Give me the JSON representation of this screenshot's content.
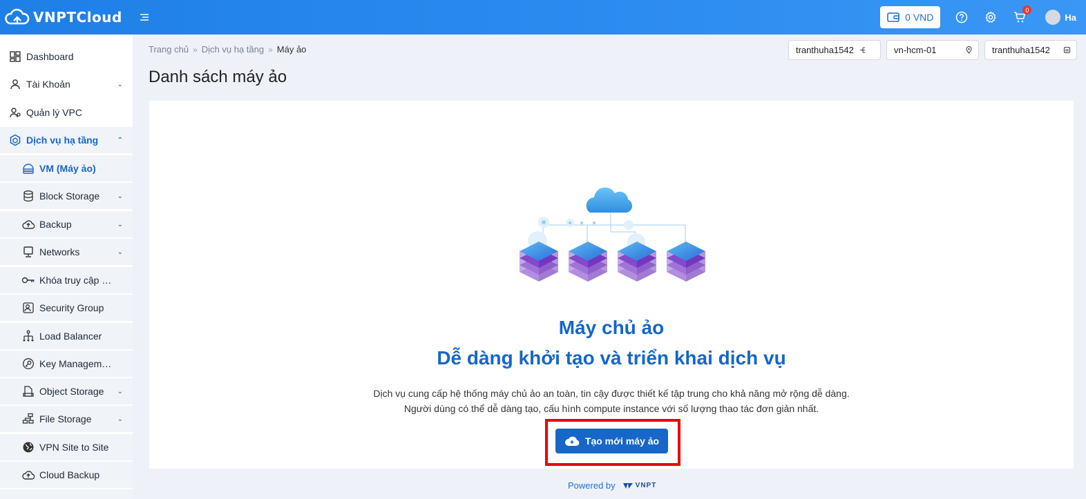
{
  "app": {
    "brand": "VNPTCloud"
  },
  "header": {
    "balance": "0 VND",
    "cart_count": "0",
    "user_name": "Ha"
  },
  "sidebar": {
    "items": [
      {
        "label": "Dashboard",
        "icon": "dashboard-icon"
      },
      {
        "label": "Tài Khoản",
        "icon": "user-icon"
      },
      {
        "label": "Quản lý VPC",
        "icon": "vpc-icon"
      },
      {
        "label": "Dịch vụ hạ tầng",
        "icon": "infrastructure-icon"
      },
      {
        "label": "VM (Máy ảo)",
        "icon": "vm-icon"
      },
      {
        "label": "Block Storage",
        "icon": "database-icon"
      },
      {
        "label": "Backup",
        "icon": "cloud-upload-icon"
      },
      {
        "label": "Networks",
        "icon": "monitor-icon"
      },
      {
        "label": "Khóa truy cập SSH",
        "icon": "key-icon"
      },
      {
        "label": "Security Group",
        "icon": "security-group-icon"
      },
      {
        "label": "Load Balancer",
        "icon": "load-balancer-icon"
      },
      {
        "label": "Key Management",
        "icon": "key-management-icon"
      },
      {
        "label": "Object Storage",
        "icon": "object-storage-icon"
      },
      {
        "label": "File Storage",
        "icon": "file-storage-icon"
      },
      {
        "label": "VPN Site to Site",
        "icon": "globe-icon"
      },
      {
        "label": "Cloud Backup",
        "icon": "cloud-backup-icon"
      }
    ]
  },
  "breadcrumb": {
    "home": "Trang chủ",
    "section": "Dịch vụ hạ tầng",
    "current": "Máy ảo"
  },
  "selectors": {
    "project": "tranthuha1542",
    "region": "vn-hcm-01",
    "account": "tranthuha1542"
  },
  "page": {
    "title": "Danh sách máy ảo"
  },
  "empty_state": {
    "title": "Máy chủ ảo",
    "subtitle": "Dễ dàng khởi tạo và triển khai dịch vụ",
    "desc_line1": "Dịch vụ cung cấp hệ thống máy chủ ảo an toàn, tin cậy được thiết kế tập trung cho khả năng mở rộng dễ dàng.",
    "desc_line2": "Người dùng có thể dễ dàng tạo, cấu hình compute instance với số lượng thao tác đơn giản nhất.",
    "cta_label": "Tạo mới máy ảo"
  },
  "footer": {
    "powered_by": "Powered by",
    "logo_text": "VNPT"
  },
  "colors": {
    "primary": "#1667c7",
    "header": "#2d8cf0",
    "highlight": "#e00000",
    "badge": "#e53935"
  }
}
